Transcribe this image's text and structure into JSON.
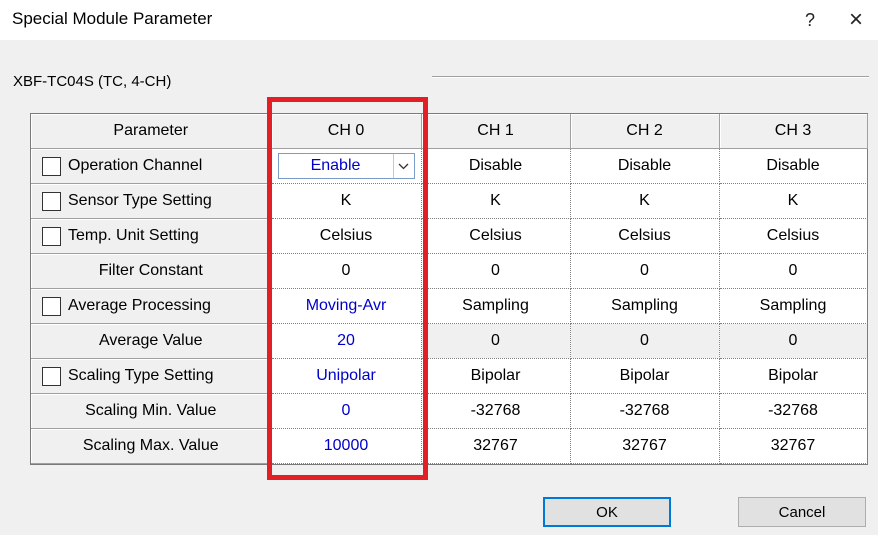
{
  "window": {
    "title": "Special Module Parameter",
    "help_label": "?",
    "close_label": "×"
  },
  "group": {
    "label": "XBF-TC04S (TC, 4-CH)"
  },
  "grid": {
    "headers": [
      "Parameter",
      "CH 0",
      "CH 1",
      "CH 2",
      "CH 3"
    ],
    "rows": [
      {
        "param": "Operation Channel",
        "checkbox": true,
        "values": [
          "Enable",
          "Disable",
          "Disable",
          "Disable"
        ]
      },
      {
        "param": "Sensor Type Setting",
        "checkbox": true,
        "values": [
          "K",
          "K",
          "K",
          "K"
        ]
      },
      {
        "param": "Temp. Unit Setting",
        "checkbox": true,
        "values": [
          "Celsius",
          "Celsius",
          "Celsius",
          "Celsius"
        ]
      },
      {
        "param": "Filter Constant",
        "checkbox": false,
        "values": [
          "0",
          "0",
          "0",
          "0"
        ]
      },
      {
        "param": "Average Processing",
        "checkbox": true,
        "values": [
          "Moving-Avr",
          "Sampling",
          "Sampling",
          "Sampling"
        ]
      },
      {
        "param": "Average Value",
        "checkbox": false,
        "values": [
          "20",
          "0",
          "0",
          "0"
        ]
      },
      {
        "param": "Scaling Type Setting",
        "checkbox": true,
        "values": [
          "Unipolar",
          "Bipolar",
          "Bipolar",
          "Bipolar"
        ]
      },
      {
        "param": "Scaling Min. Value",
        "checkbox": false,
        "values": [
          "0",
          "-32768",
          "-32768",
          "-32768"
        ]
      },
      {
        "param": "Scaling Max. Value",
        "checkbox": false,
        "values": [
          "10000",
          "32767",
          "32767",
          "32767"
        ]
      }
    ]
  },
  "buttons": {
    "ok_label": "OK",
    "cancel_label": "Cancel"
  },
  "colors": {
    "highlight": "#e31e24",
    "changed_value": "#0000cc",
    "focus_border": "#0078d7"
  }
}
